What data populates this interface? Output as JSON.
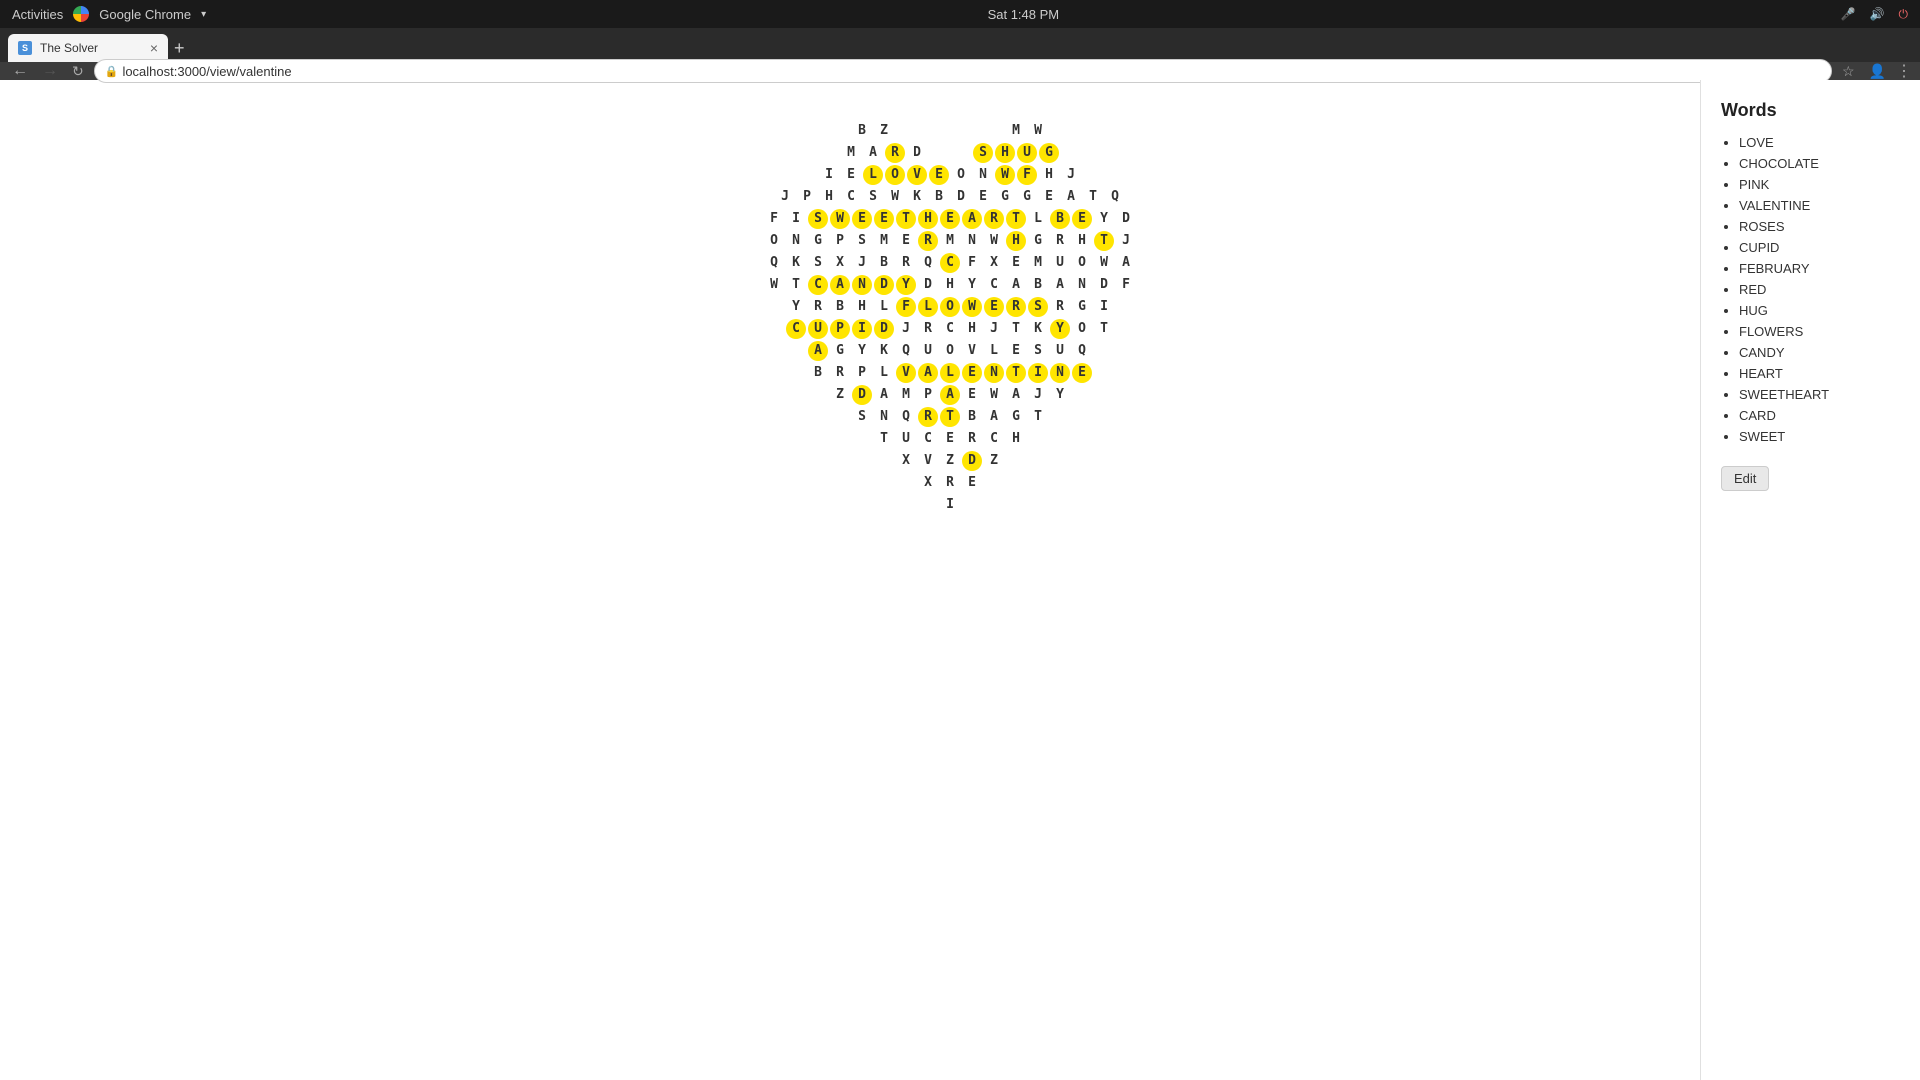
{
  "osBar": {
    "activities": "Activities",
    "chromeName": "Google Chrome",
    "time": "Sat 1:48 PM",
    "icons": [
      "mic-icon",
      "volume-icon",
      "power-icon"
    ]
  },
  "browser": {
    "tab": {
      "favicon": "S",
      "label": "The Solver",
      "closeLabel": "×"
    },
    "newTabLabel": "+",
    "navBack": "←",
    "navForward": "→",
    "navReload": "↻",
    "url": "localhost:3000/view/valentine"
  },
  "sidebar": {
    "title": "Words",
    "words": [
      "LOVE",
      "CHOCOLATE",
      "PINK",
      "VALENTINE",
      "ROSES",
      "CUPID",
      "FEBRUARY",
      "RED",
      "HUG",
      "FLOWERS",
      "CANDY",
      "HEART",
      "SWEETHEART",
      "CARD",
      "SWEET"
    ],
    "editLabel": "Edit"
  },
  "grid": {
    "rows": [
      [
        {
          "l": "B",
          "h": false
        },
        {
          "l": "Z",
          "h": false
        },
        {
          "l": "",
          "h": false
        },
        {
          "l": "",
          "h": false
        },
        {
          "l": "",
          "h": false
        },
        {
          "l": "",
          "h": false
        },
        {
          "l": "",
          "h": false
        },
        {
          "l": "M",
          "h": false
        },
        {
          "l": "W",
          "h": false
        }
      ],
      [
        {
          "l": "M",
          "h": false
        },
        {
          "l": "A",
          "h": false
        },
        {
          "l": "R",
          "h": true
        },
        {
          "l": "D",
          "h": false
        },
        {
          "l": "",
          "h": false
        },
        {
          "l": "",
          "h": false
        },
        {
          "l": "S",
          "h": true
        },
        {
          "l": "H",
          "h": true
        },
        {
          "l": "U",
          "h": true
        },
        {
          "l": "G",
          "h": true
        }
      ],
      [
        {
          "l": "I",
          "h": false
        },
        {
          "l": "E",
          "h": false
        },
        {
          "l": "L",
          "h": true
        },
        {
          "l": "O",
          "h": true
        },
        {
          "l": "V",
          "h": true
        },
        {
          "l": "E",
          "h": true
        },
        {
          "l": "O",
          "h": false
        },
        {
          "l": "N",
          "h": false
        },
        {
          "l": "W",
          "h": true
        },
        {
          "l": "F",
          "h": true
        },
        {
          "l": "H",
          "h": false
        },
        {
          "l": "J",
          "h": false
        }
      ],
      [
        {
          "l": "J",
          "h": false
        },
        {
          "l": "P",
          "h": false
        },
        {
          "l": "H",
          "h": false
        },
        {
          "l": "C",
          "h": false
        },
        {
          "l": "S",
          "h": false
        },
        {
          "l": "W",
          "h": false
        },
        {
          "l": "K",
          "h": false
        },
        {
          "l": "B",
          "h": false
        },
        {
          "l": "D",
          "h": false
        },
        {
          "l": "E",
          "h": false
        },
        {
          "l": "G",
          "h": false
        },
        {
          "l": "G",
          "h": false
        },
        {
          "l": "E",
          "h": false
        },
        {
          "l": "A",
          "h": false
        },
        {
          "l": "T",
          "h": false
        },
        {
          "l": "Q",
          "h": false
        }
      ],
      [
        {
          "l": "F",
          "h": false
        },
        {
          "l": "I",
          "h": false
        },
        {
          "l": "S",
          "h": true
        },
        {
          "l": "W",
          "h": true
        },
        {
          "l": "E",
          "h": true
        },
        {
          "l": "E",
          "h": true
        },
        {
          "l": "T",
          "h": true
        },
        {
          "l": "H",
          "h": true
        },
        {
          "l": "E",
          "h": true
        },
        {
          "l": "A",
          "h": true
        },
        {
          "l": "R",
          "h": true
        },
        {
          "l": "T",
          "h": true
        },
        {
          "l": "L",
          "h": false
        },
        {
          "l": "B",
          "h": true
        },
        {
          "l": "E",
          "h": true
        },
        {
          "l": "Y",
          "h": false
        },
        {
          "l": "D",
          "h": false
        }
      ],
      [
        {
          "l": "O",
          "h": false
        },
        {
          "l": "N",
          "h": false
        },
        {
          "l": "G",
          "h": false
        },
        {
          "l": "P",
          "h": false
        },
        {
          "l": "S",
          "h": false
        },
        {
          "l": "M",
          "h": false
        },
        {
          "l": "E",
          "h": false
        },
        {
          "l": "R",
          "h": true
        },
        {
          "l": "M",
          "h": false
        },
        {
          "l": "N",
          "h": false
        },
        {
          "l": "W",
          "h": false
        },
        {
          "l": "H",
          "h": true
        },
        {
          "l": "G",
          "h": false
        },
        {
          "l": "R",
          "h": false
        },
        {
          "l": "H",
          "h": false
        },
        {
          "l": "T",
          "h": true
        },
        {
          "l": "J",
          "h": false
        }
      ],
      [
        {
          "l": "Q",
          "h": false
        },
        {
          "l": "K",
          "h": false
        },
        {
          "l": "S",
          "h": false
        },
        {
          "l": "X",
          "h": false
        },
        {
          "l": "J",
          "h": false
        },
        {
          "l": "B",
          "h": false
        },
        {
          "l": "R",
          "h": false
        },
        {
          "l": "Q",
          "h": false
        },
        {
          "l": "C",
          "h": true
        },
        {
          "l": "F",
          "h": false
        },
        {
          "l": "X",
          "h": false
        },
        {
          "l": "E",
          "h": false
        },
        {
          "l": "M",
          "h": false
        },
        {
          "l": "U",
          "h": false
        },
        {
          "l": "O",
          "h": false
        },
        {
          "l": "W",
          "h": false
        },
        {
          "l": "A",
          "h": false
        }
      ],
      [
        {
          "l": "W",
          "h": false
        },
        {
          "l": "T",
          "h": false
        },
        {
          "l": "C",
          "h": true
        },
        {
          "l": "A",
          "h": true
        },
        {
          "l": "N",
          "h": true
        },
        {
          "l": "D",
          "h": true
        },
        {
          "l": "Y",
          "h": true
        },
        {
          "l": "D",
          "h": false
        },
        {
          "l": "H",
          "h": false
        },
        {
          "l": "Y",
          "h": false
        },
        {
          "l": "C",
          "h": false
        },
        {
          "l": "A",
          "h": false
        },
        {
          "l": "B",
          "h": false
        },
        {
          "l": "A",
          "h": false
        },
        {
          "l": "N",
          "h": false
        },
        {
          "l": "D",
          "h": false
        },
        {
          "l": "F",
          "h": false
        }
      ],
      [
        {
          "l": "Y",
          "h": false
        },
        {
          "l": "R",
          "h": false
        },
        {
          "l": "B",
          "h": false
        },
        {
          "l": "H",
          "h": false
        },
        {
          "l": "L",
          "h": false
        },
        {
          "l": "F",
          "h": true
        },
        {
          "l": "L",
          "h": true
        },
        {
          "l": "O",
          "h": true
        },
        {
          "l": "W",
          "h": true
        },
        {
          "l": "E",
          "h": true
        },
        {
          "l": "R",
          "h": true
        },
        {
          "l": "S",
          "h": true
        },
        {
          "l": "R",
          "h": false
        },
        {
          "l": "G",
          "h": false
        },
        {
          "l": "I",
          "h": false
        }
      ],
      [
        {
          "l": "C",
          "h": true
        },
        {
          "l": "U",
          "h": true
        },
        {
          "l": "P",
          "h": true
        },
        {
          "l": "I",
          "h": true
        },
        {
          "l": "D",
          "h": true
        },
        {
          "l": "J",
          "h": false
        },
        {
          "l": "R",
          "h": false
        },
        {
          "l": "C",
          "h": false
        },
        {
          "l": "H",
          "h": false
        },
        {
          "l": "J",
          "h": false
        },
        {
          "l": "T",
          "h": false
        },
        {
          "l": "K",
          "h": false
        },
        {
          "l": "Y",
          "h": true
        },
        {
          "l": "O",
          "h": false
        },
        {
          "l": "T",
          "h": false
        }
      ],
      [
        {
          "l": "A",
          "h": true
        },
        {
          "l": "G",
          "h": false
        },
        {
          "l": "Y",
          "h": false
        },
        {
          "l": "K",
          "h": false
        },
        {
          "l": "Q",
          "h": false
        },
        {
          "l": "U",
          "h": false
        },
        {
          "l": "O",
          "h": false
        },
        {
          "l": "V",
          "h": false
        },
        {
          "l": "L",
          "h": false
        },
        {
          "l": "E",
          "h": false
        },
        {
          "l": "S",
          "h": false
        },
        {
          "l": "U",
          "h": false
        },
        {
          "l": "Q",
          "h": false
        }
      ],
      [
        {
          "l": "B",
          "h": false
        },
        {
          "l": "R",
          "h": false
        },
        {
          "l": "P",
          "h": false
        },
        {
          "l": "L",
          "h": false
        },
        {
          "l": "V",
          "h": true
        },
        {
          "l": "A",
          "h": true
        },
        {
          "l": "L",
          "h": true
        },
        {
          "l": "E",
          "h": true
        },
        {
          "l": "N",
          "h": true
        },
        {
          "l": "T",
          "h": true
        },
        {
          "l": "I",
          "h": true
        },
        {
          "l": "N",
          "h": true
        },
        {
          "l": "E",
          "h": true
        }
      ],
      [
        {
          "l": "Z",
          "h": false
        },
        {
          "l": "D",
          "h": true
        },
        {
          "l": "A",
          "h": false
        },
        {
          "l": "M",
          "h": false
        },
        {
          "l": "P",
          "h": false
        },
        {
          "l": "A",
          "h": true
        },
        {
          "l": "E",
          "h": false
        },
        {
          "l": "W",
          "h": false
        },
        {
          "l": "A",
          "h": false
        },
        {
          "l": "J",
          "h": false
        },
        {
          "l": "Y",
          "h": false
        }
      ],
      [
        {
          "l": "S",
          "h": false
        },
        {
          "l": "N",
          "h": false
        },
        {
          "l": "Q",
          "h": false
        },
        {
          "l": "R",
          "h": true
        },
        {
          "l": "T",
          "h": true
        },
        {
          "l": "B",
          "h": false
        },
        {
          "l": "A",
          "h": false
        },
        {
          "l": "G",
          "h": false
        },
        {
          "l": "T",
          "h": false
        }
      ],
      [
        {
          "l": "T",
          "h": false
        },
        {
          "l": "U",
          "h": false
        },
        {
          "l": "C",
          "h": false
        },
        {
          "l": "E",
          "h": false
        },
        {
          "l": "R",
          "h": false
        },
        {
          "l": "C",
          "h": false
        },
        {
          "l": "H",
          "h": false
        }
      ],
      [
        {
          "l": "X",
          "h": false
        },
        {
          "l": "V",
          "h": false
        },
        {
          "l": "Z",
          "h": false
        },
        {
          "l": "D",
          "h": true
        },
        {
          "l": "Z",
          "h": false
        }
      ],
      [
        {
          "l": "X",
          "h": false
        },
        {
          "l": "R",
          "h": false
        },
        {
          "l": "E",
          "h": false
        }
      ],
      [
        {
          "l": "I",
          "h": false
        }
      ]
    ]
  }
}
